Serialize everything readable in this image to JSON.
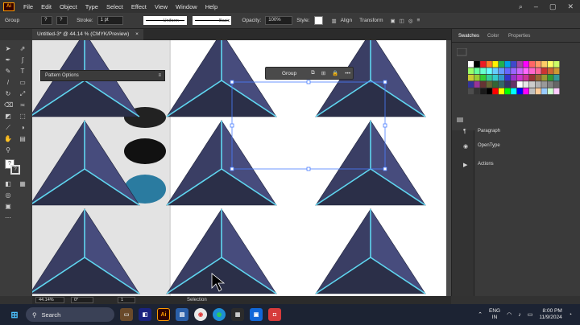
{
  "menubar": {
    "logo": "Ai",
    "items": [
      "File",
      "Edit",
      "Object",
      "Type",
      "Select",
      "Effect",
      "View",
      "Window",
      "Help"
    ]
  },
  "controlbar": {
    "selection_label": "Group",
    "stroke_label": "Stroke:",
    "stroke_value": "1 pt",
    "profile_label": "Uniform",
    "brush_label": "Basic",
    "opacity_label": "Opacity:",
    "opacity_value": "100%",
    "style_label": "Style:",
    "align_label": "Align",
    "transform_label": "Transform"
  },
  "document": {
    "tab_title": "Untitled-3* @ 44.14 % (CMYK/Preview)",
    "close_glyph": "×"
  },
  "context_bar": {
    "label": "Group",
    "more": "•••"
  },
  "pattern_panel": {
    "title": "Pattern Options"
  },
  "right_panel": {
    "tabs": [
      "Swatches",
      "Color",
      "Properties"
    ],
    "sections": [
      "Paragraph",
      "OpenType",
      "Actions"
    ]
  },
  "statusbar": {
    "zoom": "44.14%",
    "rotation": "0°",
    "artboard": "1",
    "tool": "Selection"
  },
  "taskbar": {
    "search_placeholder": "Search",
    "lang_top": "ENG",
    "lang_bottom": "IN",
    "time": "8:00 PM",
    "date": "11/9/2024"
  },
  "colors": {
    "pyramid_dark": "#2b2f48",
    "pyramid_mid": "#3a3e64",
    "pyramid_light": "#474c7d",
    "ridge_glow": "#5fd6f0",
    "accent_orange": "#ff9a00"
  }
}
